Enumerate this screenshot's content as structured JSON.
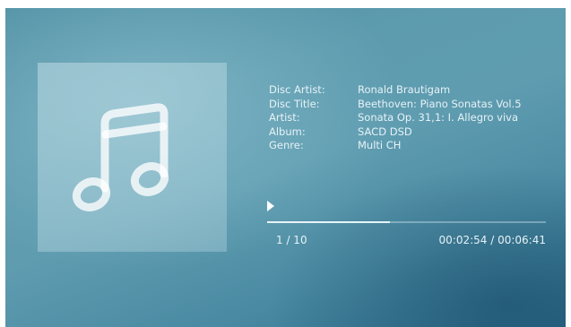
{
  "player": {
    "album_art_icon": "music-note-icon",
    "info": [
      {
        "label": "Disc Artist:",
        "value": "Ronald Brautigam"
      },
      {
        "label": "Disc Title:",
        "value": "Beethoven: Piano Sonatas Vol.5"
      },
      {
        "label": "Artist:",
        "value": "Sonata Op. 31,1: I. Allegro viva"
      },
      {
        "label": "Album:",
        "value": "SACD DSD"
      },
      {
        "label": "Genre:",
        "value": "Multi CH"
      }
    ],
    "play_state_icon": "play-icon",
    "progress_fraction": 0.44,
    "track_counter": "1 / 10",
    "time_display": "00:02:54 / 00:06:41"
  },
  "colors": {
    "text": "#e7f2f6",
    "progress_fill": "#e8f3f7",
    "background_accent": "#5f9cb0"
  }
}
